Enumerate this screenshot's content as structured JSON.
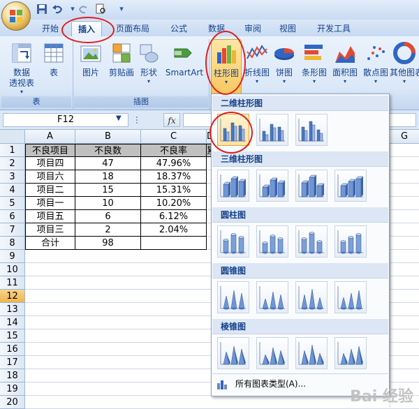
{
  "tabs": [
    "开始",
    "插入",
    "页面布局",
    "公式",
    "数据",
    "审阅",
    "视图",
    "开发工具"
  ],
  "active_tab": "插入",
  "ribbon": {
    "group_table": {
      "title": "表",
      "buttons": [
        "数据\n透视表",
        "表"
      ],
      "pivot_arrow": "▾"
    },
    "group_illustrations": {
      "title": "插图",
      "buttons": [
        "图片",
        "剪贴画",
        "形状",
        "SmartArt"
      ],
      "shape_arrow": "▾"
    },
    "chart_buttons": [
      "柱形图",
      "折线图",
      "饼图",
      "条形图",
      "面积图",
      "散点图",
      "其他图表"
    ],
    "arrow_glyph": "▾"
  },
  "formula_bar": {
    "name_box": "F12",
    "fx_label": "fx"
  },
  "sheet": {
    "columns": [
      "A",
      "B",
      "C",
      "D",
      "E",
      "F",
      "G"
    ],
    "rows": [
      "1",
      "2",
      "3",
      "4",
      "5",
      "6",
      "7",
      "8",
      "9",
      "10",
      "11",
      "12",
      "13",
      "14",
      "15",
      "16",
      "17",
      "18",
      "19",
      "20"
    ],
    "selected_row": "12",
    "header": [
      "不良项目",
      "不良数",
      "不良率"
    ],
    "data": [
      [
        "项目四",
        "47",
        "47.96%"
      ],
      [
        "项目六",
        "18",
        "18.37%"
      ],
      [
        "项目二",
        "15",
        "15.31%"
      ],
      [
        "项目一",
        "10",
        "10.20%"
      ],
      [
        "项目五",
        "6",
        "6.12%"
      ],
      [
        "项目三",
        "2",
        "2.04%"
      ],
      [
        "合计",
        "98",
        ""
      ]
    ],
    "d1_partial": "累"
  },
  "dropdown": {
    "sections": [
      "二维柱形图",
      "三维柱形图",
      "圆柱图",
      "圆锥图",
      "棱锥图"
    ],
    "footer": "所有图表类型(A)..."
  },
  "watermark": "Bai 经验"
}
